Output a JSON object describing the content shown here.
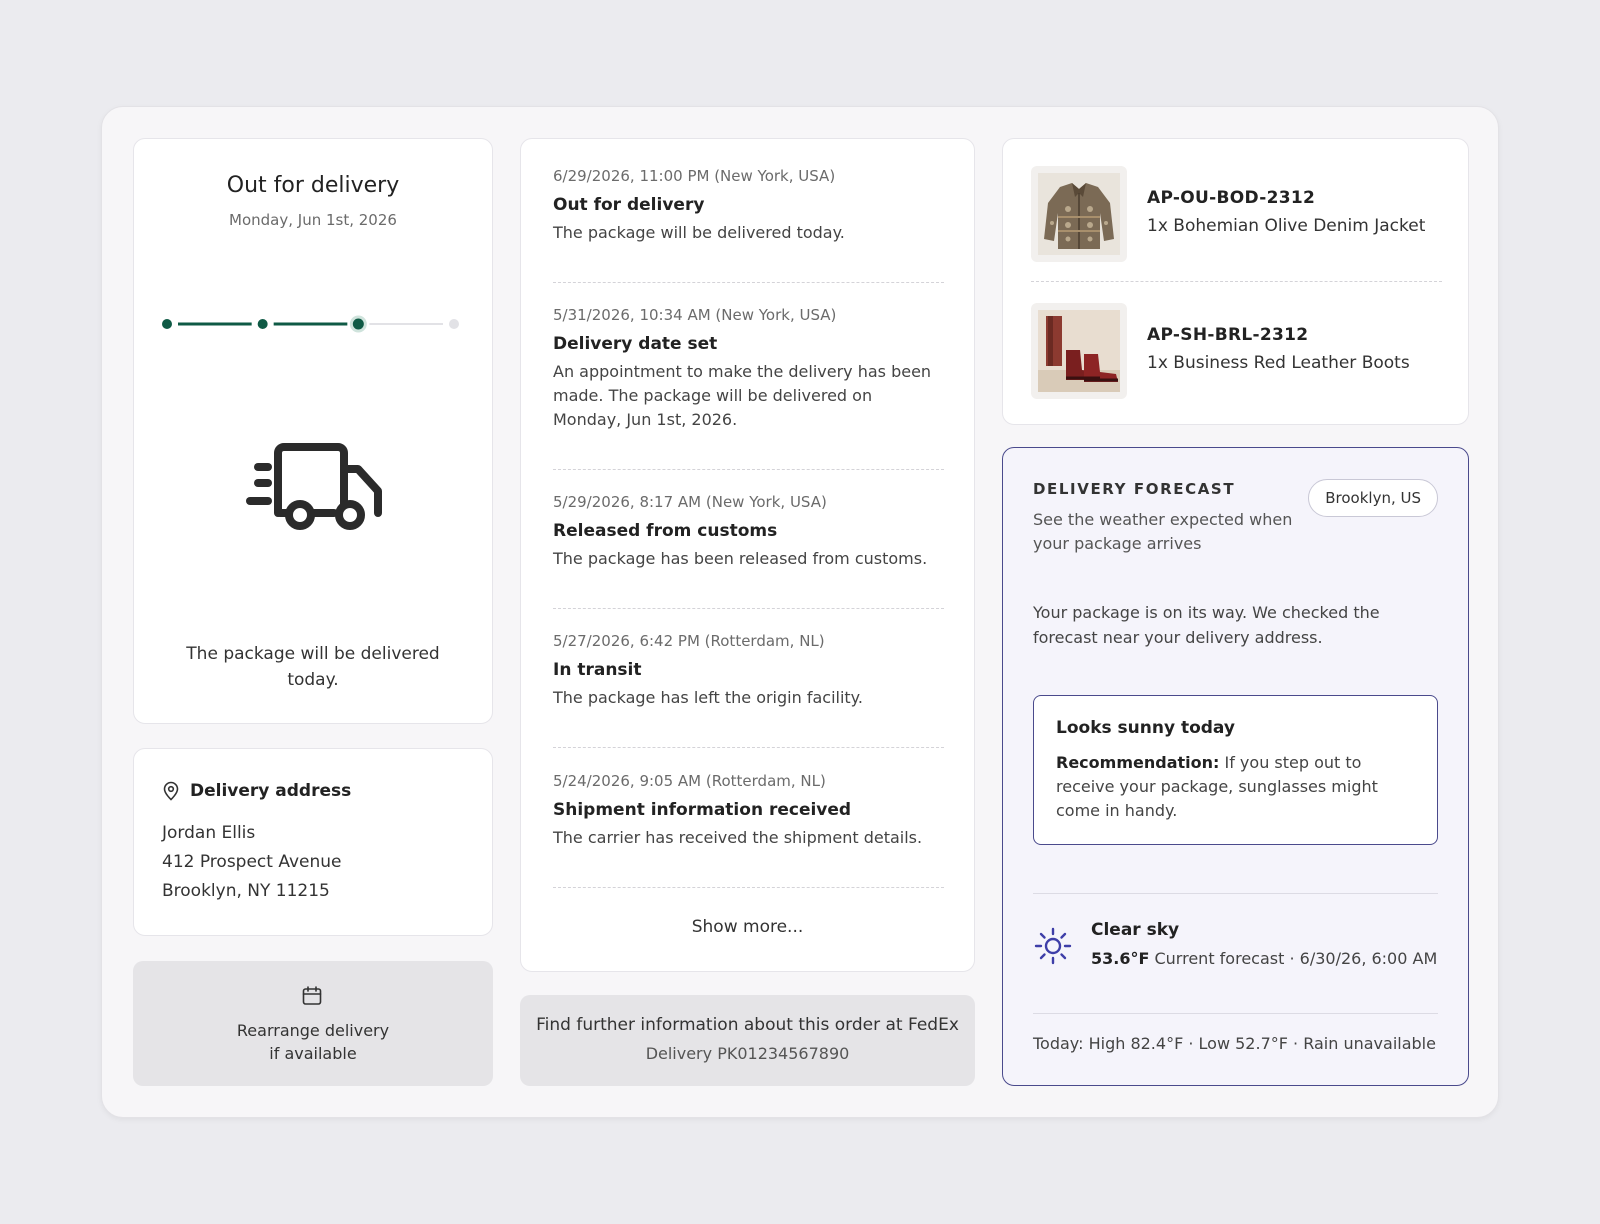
{
  "status": {
    "title": "Out for delivery",
    "date": "Monday, Jun 1st, 2026",
    "message": "The package will be delivered today.",
    "progress": {
      "steps": 4,
      "current_step": 3
    },
    "colors": {
      "accent": "#0f5a45",
      "inactive": "#e2e2e6"
    }
  },
  "address": {
    "heading": "Delivery address",
    "name": "Jordan Ellis",
    "street": "412 Prospect Avenue",
    "city": "Brooklyn, NY 11215"
  },
  "rearrange": {
    "label": "Rearrange delivery\nif available"
  },
  "timeline": [
    {
      "date": "6/29/2026, 11:00 PM (New York, USA)",
      "title": "Out for delivery",
      "description": "The package will be delivered today."
    },
    {
      "date": "5/31/2026, 10:34 AM (New York, USA)",
      "title": "Delivery date set",
      "description": "An appointment to make the delivery has been made. The package will be delivered on Monday, Jun 1st, 2026."
    },
    {
      "date": "5/29/2026, 8:17 AM (New York, USA)",
      "title": "Released from customs",
      "description": "The package has been released from customs."
    },
    {
      "date": "5/27/2026, 6:42 PM (Rotterdam, NL)",
      "title": "In transit",
      "description": "The package has left the origin facility."
    },
    {
      "date": "5/24/2026, 9:05 AM (Rotterdam, NL)",
      "title": "Shipment information received",
      "description": "The carrier has received the shipment details."
    }
  ],
  "show_more_label": "Show more...",
  "fedex": {
    "line1": "Find further information about this order at FedEx",
    "line2": "Delivery PK01234567890"
  },
  "products": [
    {
      "sku": "AP-OU-BOD-2312",
      "name": "1x Bohemian Olive Denim Jacket"
    },
    {
      "sku": "AP-SH-BRL-2312",
      "name": "1x Business Red Leather Boots"
    }
  ],
  "forecast": {
    "kicker": "DELIVERY FORECAST",
    "subtitle": "See the weather expected when your package arrives",
    "location": "Brooklyn, US",
    "intro": "Your package is on its way. We checked the forecast near your delivery address.",
    "box_title": "Looks sunny today",
    "recommendation_label": "Recommendation:",
    "recommendation_text": " If you step out to receive your package, sunglasses might come in handy.",
    "condition": "Clear sky",
    "current_temp": "53.6°F",
    "current_detail": " Current forecast · 6/30/26, 6:00 AM",
    "today_summary": "Today: High 82.4°F · Low 52.7°F · Rain unavailable",
    "accent": "#3e3ea8"
  }
}
